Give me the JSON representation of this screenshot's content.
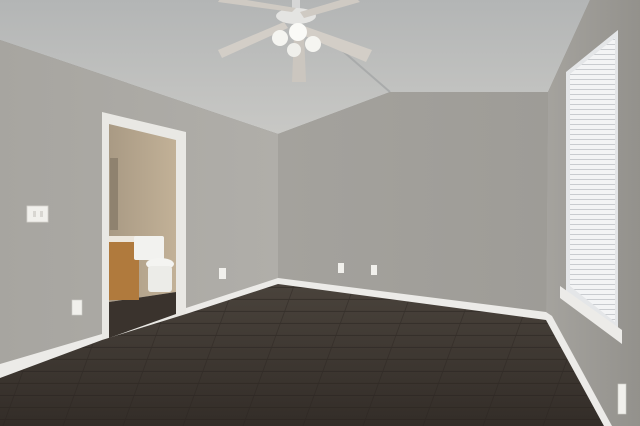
{
  "scene": {
    "subject": "empty-bedroom-interior",
    "elements": [
      "textured-vaulted-ceiling",
      "ceiling-fan-with-light",
      "doorway-to-bathroom",
      "bathroom-vanity",
      "toilet",
      "light-switch-plate",
      "electrical-outlets",
      "window-with-blinds",
      "white-baseboards",
      "dark-wood-plank-floor"
    ],
    "colors": {
      "wall_left": "#a9a7a2",
      "wall_back": "#a3a19c",
      "wall_right": "#9d9b96",
      "ceiling": "#bfc0bf",
      "floor": "#3f3933",
      "baseboard": "#ececea",
      "bathroom_wall": "#b7a58c",
      "vanity": "#b07a3d",
      "window_light": "#f4f6f8"
    }
  }
}
